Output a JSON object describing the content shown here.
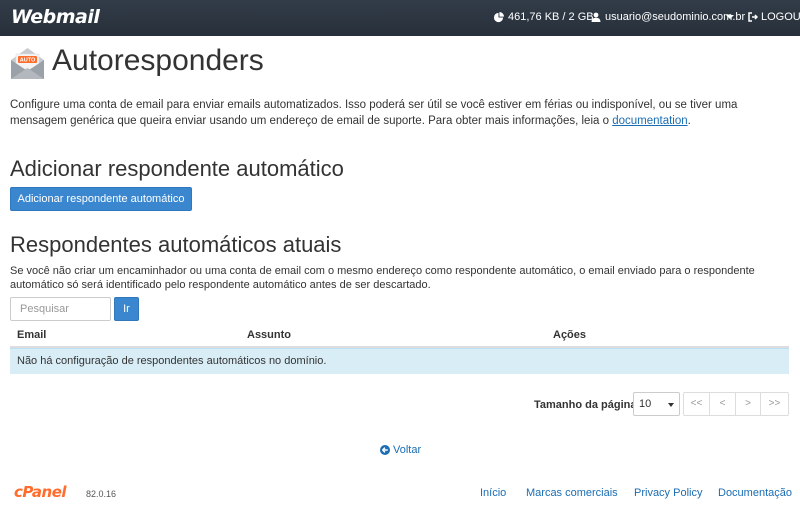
{
  "topbar": {
    "brand": "Webmail",
    "disk_usage": "461,76 KB / 2 GB",
    "user": "usuario@seudominio.com.br",
    "logout": "LOGOUT"
  },
  "page": {
    "icon_label": "AUTO",
    "title": "Autoresponders",
    "description": "Configure uma conta de email para enviar emails automatizados. Isso poderá ser útil se você estiver em férias ou indisponível, ou se tiver uma mensagem genérica que queira enviar usando um endereço de email de suporte. Para obter mais informações, leia o ",
    "description_link": "documentation",
    "description_end": "."
  },
  "add_section": {
    "heading": "Adicionar respondente automático",
    "button": "Adicionar respondente automático"
  },
  "current_section": {
    "heading": "Respondentes automáticos atuais",
    "note": "Se você não criar um encaminhador ou uma conta de email com o mesmo endereço como respondente automático, o email enviado para o respondente automático só será identificado pelo respondente automático antes de ser descartado.",
    "search_placeholder": "Pesquisar",
    "search_button": "Ir",
    "columns": [
      "Email",
      "Assunto",
      "Ações"
    ],
    "empty_message": "Não há configuração de respondentes automáticos no domínio."
  },
  "pagination": {
    "label": "Tamanho da página",
    "page_size": "10",
    "buttons": [
      "<<",
      "<",
      ">",
      ">>"
    ]
  },
  "back_link": "Voltar",
  "footer": {
    "logo": "cPanel",
    "version": "82.0.16",
    "links": [
      "Início",
      "Marcas comerciais",
      "Privacy Policy",
      "Documentação"
    ]
  },
  "colors": {
    "topbar": "#2c3e50",
    "primary_button": "#3a87cf",
    "link": "#1a6db3",
    "empty_row": "#d9edf7",
    "cpanel_orange": "#ff6c2c"
  }
}
